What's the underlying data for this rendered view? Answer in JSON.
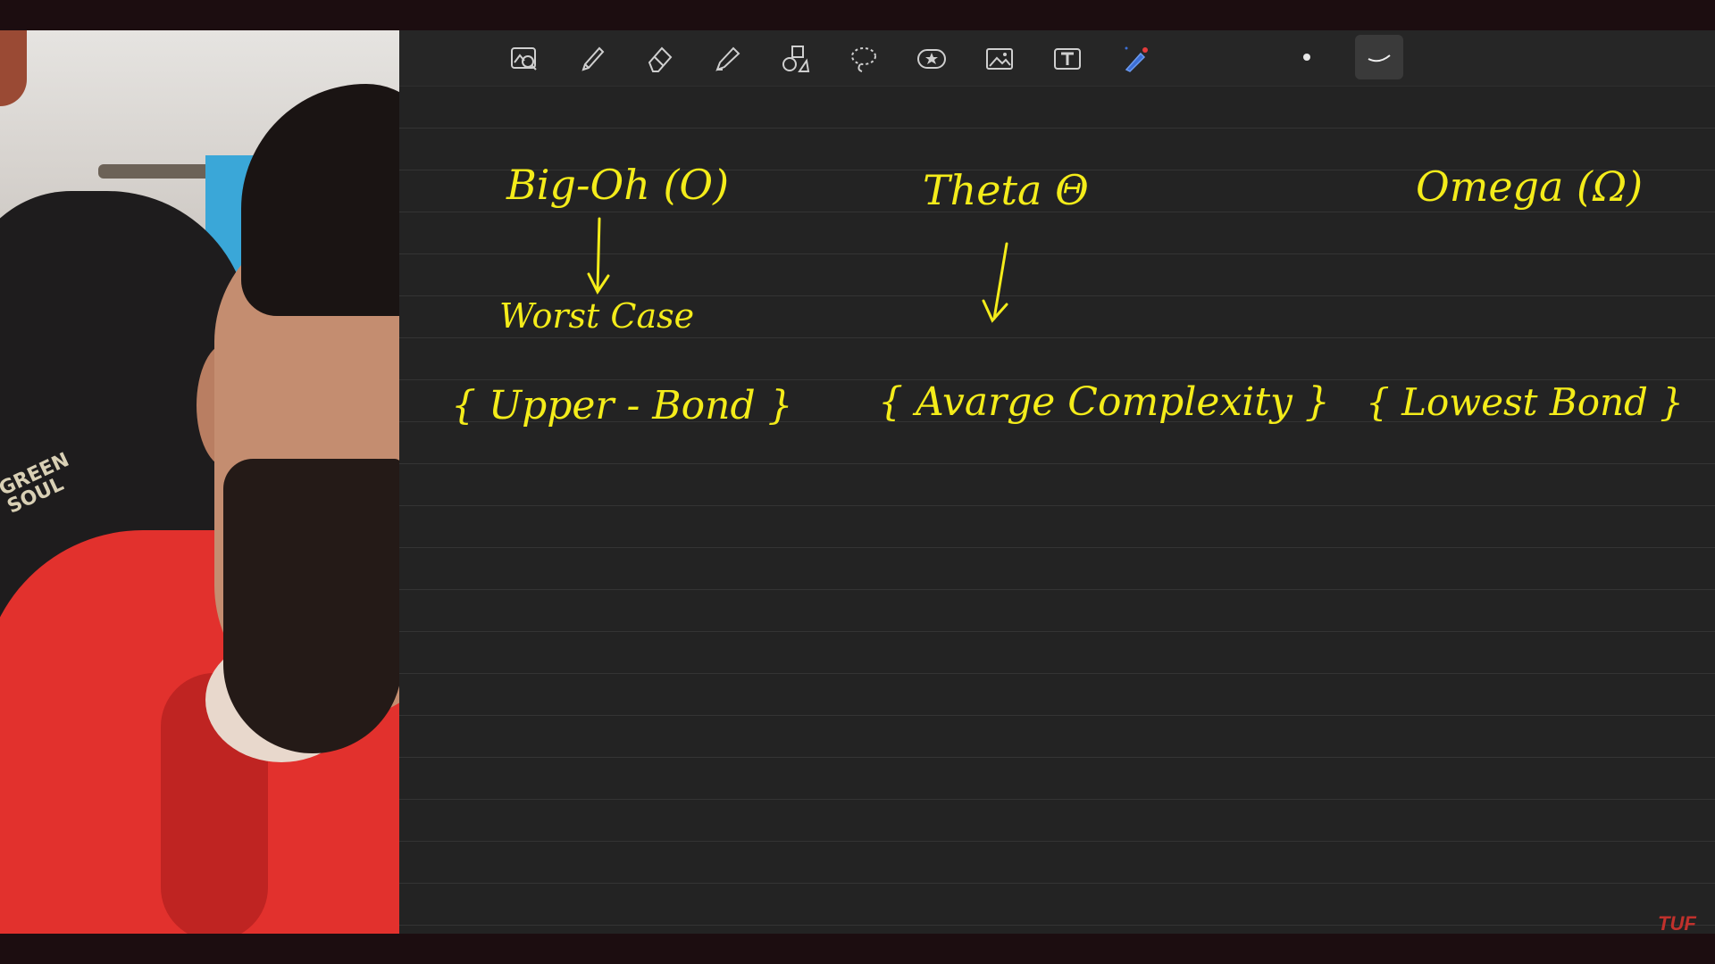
{
  "toolbar": {
    "tools": [
      {
        "icon": "zoom-image-icon"
      },
      {
        "icon": "pen-icon"
      },
      {
        "icon": "eraser-icon"
      },
      {
        "icon": "highlighter-icon"
      },
      {
        "icon": "shapes-icon"
      },
      {
        "icon": "lasso-icon"
      },
      {
        "icon": "sticker-star-icon"
      },
      {
        "icon": "image-insert-icon"
      },
      {
        "icon": "text-tool-icon"
      },
      {
        "icon": "laser-pointer-icon"
      },
      {
        "icon": "pen-size-dot-icon"
      },
      {
        "icon": "stroke-style-icon",
        "active": true
      }
    ]
  },
  "notes": {
    "big_oh": "Big-Oh (O)",
    "worst_case": "Worst Case",
    "upper_bound": "{ Upper - Bond }",
    "theta": "Theta Θ",
    "average": "{ Avarge Complexity }",
    "omega": "Omega (Ω)",
    "lower_bound": "{ Lowest Bond }"
  },
  "watermark": "TUF",
  "presenter": {
    "chair_brand": "GREEN SOUL"
  },
  "colors": {
    "ink": "#f4ec1a",
    "canvas": "#232323",
    "toolbar": "#262626",
    "frame": "#1c0d10",
    "watermark": "#c0312c"
  }
}
